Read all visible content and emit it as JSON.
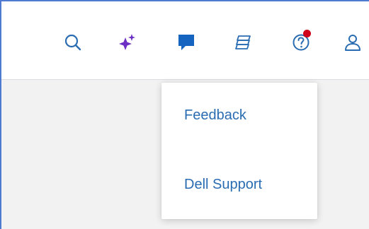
{
  "toolbar": {
    "icons": [
      {
        "icon": "search-icon"
      },
      {
        "icon": "ai-sparkle-icon"
      },
      {
        "icon": "feedback-chat-icon"
      },
      {
        "icon": "layers-icon"
      },
      {
        "icon": "help-icon",
        "has_notification": true
      },
      {
        "icon": "user-icon"
      }
    ]
  },
  "menu": {
    "items": [
      {
        "label": "Feedback"
      },
      {
        "label": "Dell Support"
      }
    ]
  },
  "colors": {
    "icon_blue": "#2a6cb2",
    "feedback_blue": "#1565c0",
    "ai_purple": "#6b2fc4",
    "notification_red": "#d0021b",
    "frame_border": "#4f7ad1"
  }
}
